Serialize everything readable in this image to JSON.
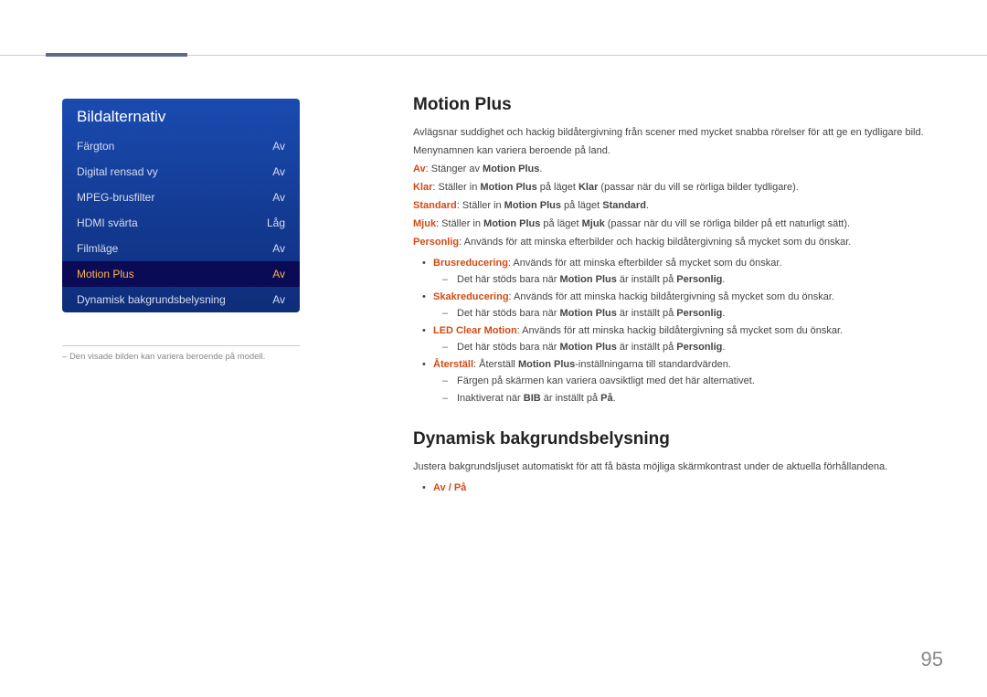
{
  "sidebar": {
    "title": "Bildalternativ",
    "items": [
      {
        "label": "Färgton",
        "value": "Av",
        "selected": false
      },
      {
        "label": "Digital rensad vy",
        "value": "Av",
        "selected": false
      },
      {
        "label": "MPEG-brusfilter",
        "value": "Av",
        "selected": false
      },
      {
        "label": "HDMI svärta",
        "value": "Låg",
        "selected": false
      },
      {
        "label": "Filmläge",
        "value": "Av",
        "selected": false
      },
      {
        "label": "Motion Plus",
        "value": "Av",
        "selected": true
      },
      {
        "label": "Dynamisk bakgrundsbelysning",
        "value": "Av",
        "selected": false
      }
    ],
    "note_prefix": "–",
    "note": "Den visade bilden kan variera beroende på modell."
  },
  "main": {
    "section1": {
      "heading": "Motion Plus",
      "intro1": "Avlägsnar suddighet och hackig bildåtergivning från scener med mycket snabba rörelser för att ge en tydligare bild.",
      "intro2": "Menynamnen kan variera beroende på land.",
      "lines": {
        "av": {
          "accent": "Av",
          "rest": ": Stänger av ",
          "accent2": "Motion Plus",
          "rest2": "."
        },
        "klar": {
          "accent": "Klar",
          "rest": ": Ställer in ",
          "b1": "Motion Plus",
          "rest2": " på läget ",
          "b2": "Klar",
          "rest3": " (passar när du vill se rörliga bilder tydligare)."
        },
        "standard": {
          "accent": "Standard",
          "rest": ": Ställer in ",
          "b1": "Motion Plus",
          "rest2": " på läget ",
          "b2": "Standard",
          "rest3": "."
        },
        "mjuk": {
          "accent": "Mjuk",
          "rest": ": Ställer in ",
          "b1": "Motion Plus",
          "rest2": " på läget ",
          "b2": "Mjuk",
          "rest3": " (passar när du vill se rörliga bilder på ett naturligt sätt)."
        },
        "personlig": {
          "accent": "Personlig",
          "rest": ": Används för att minska efterbilder och hackig bildåtergivning så mycket som du önskar."
        }
      },
      "bullets": {
        "brus": {
          "accent": "Brusreducering",
          "rest": ": Används för att minska efterbilder så mycket som du önskar."
        },
        "brus_sub": {
          "t1": "Det här stöds bara när ",
          "b1": "Motion Plus",
          "t2": " är inställt på ",
          "b2": "Personlig",
          "t3": "."
        },
        "skak": {
          "accent": "Skakreducering",
          "rest": ": Används för att minska hackig bildåtergivning så mycket som du önskar."
        },
        "skak_sub": {
          "t1": "Det här stöds bara när ",
          "b1": "Motion Plus",
          "t2": " är inställt på ",
          "b2": "Personlig",
          "t3": "."
        },
        "led": {
          "accent": "LED Clear Motion",
          "rest": ": Används för att minska hackig bildåtergivning så mycket som du önskar."
        },
        "led_sub": {
          "t1": "Det här stöds bara när ",
          "b1": "Motion Plus",
          "t2": " är inställt på ",
          "b2": "Personlig",
          "t3": "."
        },
        "reset": {
          "accent": "Återställ",
          "rest": ": Återställ ",
          "b1": "Motion Plus",
          "rest2": "-inställningarna till standardvärden."
        },
        "reset_sub1": "Färgen på skärmen kan variera oavsiktligt med det här alternativet.",
        "reset_sub2": {
          "t1": "Inaktiverat när ",
          "b1": "BIB",
          "t2": " är inställt på ",
          "b2": "På",
          "t3": "."
        }
      }
    },
    "section2": {
      "heading": "Dynamisk bakgrundsbelysning",
      "intro": "Justera bakgrundsljuset automatiskt för att få bästa möjliga skärmkontrast under de aktuella förhållandena.",
      "options": "Av / På"
    }
  },
  "page": "95"
}
